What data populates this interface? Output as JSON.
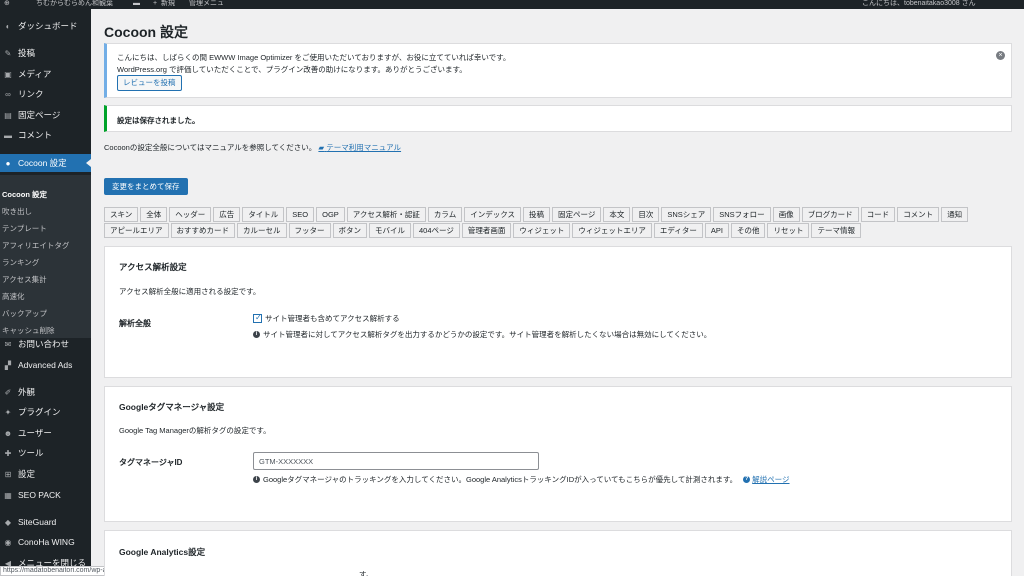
{
  "admin_bar": {
    "site": "ちむからむらめん和観葉",
    "new": "新規",
    "manage": "管理メニュ",
    "greeting": "こんにちは、tobenaitakao3008 さん"
  },
  "sidebar": {
    "items": [
      {
        "label": "ダッシュボード",
        "icon": "dashboard-icon",
        "glyph": "◐"
      },
      {
        "label": "投稿",
        "icon": "pin-icon",
        "glyph": "✎"
      },
      {
        "label": "メディア",
        "icon": "media-icon",
        "glyph": "▣"
      },
      {
        "label": "リンク",
        "icon": "link-icon",
        "glyph": "∞"
      },
      {
        "label": "固定ページ",
        "icon": "page-icon",
        "glyph": "▤"
      },
      {
        "label": "コメント",
        "icon": "comment-icon",
        "glyph": "▬"
      },
      {
        "label": "Cocoon 設定",
        "icon": "cocoon-icon",
        "glyph": "●"
      },
      {
        "label": "お問い合わせ",
        "icon": "mail-icon",
        "glyph": "✉"
      },
      {
        "label": "Advanced Ads",
        "icon": "ads-icon",
        "glyph": "▞"
      },
      {
        "label": "外観",
        "icon": "appearance-icon",
        "glyph": "✐"
      },
      {
        "label": "プラグイン",
        "icon": "plugin-icon",
        "glyph": "✦"
      },
      {
        "label": "ユーザー",
        "icon": "user-icon",
        "glyph": "☻"
      },
      {
        "label": "ツール",
        "icon": "tool-icon",
        "glyph": "✚"
      },
      {
        "label": "設定",
        "icon": "settings-icon",
        "glyph": "⊞"
      },
      {
        "label": "SEO PACK",
        "icon": "seo-icon",
        "glyph": "▦"
      },
      {
        "label": "SiteGuard",
        "icon": "siteguard-icon",
        "glyph": "◆"
      },
      {
        "label": "ConoHa WING",
        "icon": "conoha-icon",
        "glyph": "◉"
      },
      {
        "label": "メニューを閉じる",
        "icon": "collapse-icon",
        "glyph": "◀"
      }
    ],
    "submenu": [
      "Cocoon 設定",
      "吹き出し",
      "テンプレート",
      "アフィリエイトタグ",
      "ランキング",
      "アクセス集計",
      "高速化",
      "バックアップ",
      "キャッシュ削除"
    ]
  },
  "status_url": "https://madatobenaitori.com/wp-admin/admin.php?page=theme-settings",
  "page": {
    "title": "Cocoon 設定",
    "notice_line1": "こんにちは、しばらくの間 EWWW Image Optimizer をご使用いただいておりますが、お役に立てていれば幸いです。",
    "notice_line2": "WordPress.org で評価していただくことで、プラグイン改善の助けになります。ありがとうございます。",
    "review_button": "レビューを投稿",
    "saved": "設定は保存されました。",
    "manual_text": "Cocoonの設定全般についてはマニュアルを参照してください。",
    "manual_link": "テーマ利用マニュアル",
    "save_button": "変更をまとめて保存"
  },
  "tabs": {
    "row1": [
      "スキン",
      "全体",
      "ヘッダー",
      "広告",
      "タイトル",
      "SEO",
      "OGP",
      "アクセス解析・認証",
      "カラム",
      "インデックス",
      "投稿",
      "固定ページ",
      "本文",
      "目次",
      "SNSシェア",
      "SNSフォロー",
      "画像",
      "ブログカード",
      "コード",
      "コメント",
      "通知"
    ],
    "row2": [
      "アピールエリア",
      "おすすめカード",
      "カルーセル",
      "フッター",
      "ボタン",
      "モバイル",
      "404ページ",
      "管理者画面",
      "ウィジェット",
      "ウィジェットエリア",
      "エディター",
      "API",
      "その他",
      "リセット",
      "テーマ情報"
    ]
  },
  "access": {
    "heading": "アクセス解析設定",
    "desc": "アクセス解析全般に適用される設定です。",
    "label": "解析全般",
    "checkbox": "サイト管理者も含めてアクセス解析する",
    "checked": true,
    "help": "サイト管理者に対してアクセス解析タグを出力するかどうかの設定です。サイト管理者を解析したくない場合は無効にしてください。"
  },
  "gtm": {
    "heading": "Googleタグマネージャ設定",
    "desc": "Google Tag Managerの解析タグの設定です。",
    "label": "タグマネージャID",
    "placeholder": "GTM-XXXXXXX",
    "help": "Googleタグマネージャのトラッキングを入力してください。Google AnalyticsトラッキングIDが入っていてもこちらが優先して計測されます。",
    "help_link": "解説ページ"
  },
  "ga": {
    "heading": "Google Analytics設定",
    "desc_tail": "す。"
  },
  "colors": {
    "accent": "#2271b1",
    "sidebar": "#1d2327",
    "success": "#00a32a"
  }
}
